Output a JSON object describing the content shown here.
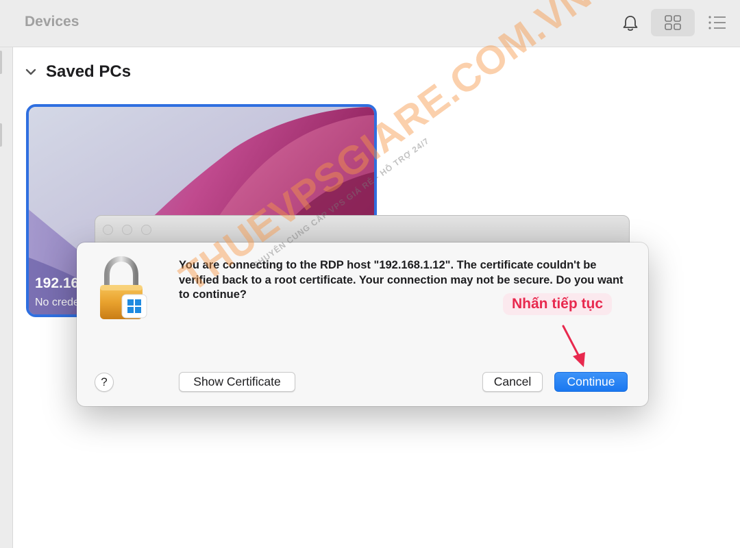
{
  "toolbar": {
    "title": "Devices",
    "icons": [
      "bell-icon",
      "grid-view-icon",
      "list-view-icon"
    ]
  },
  "section": {
    "title": "Saved PCs",
    "icon": "chevron-down-icon"
  },
  "pc_card": {
    "name": "192.16",
    "status": "No crede"
  },
  "dialog": {
    "message": "You are connecting to the RDP host \"192.168.1.12\". The certificate couldn't be verified back to a root certificate. Your connection may not be secure. Do you want to continue?",
    "help_label": "?",
    "show_certificate_label": "Show Certificate",
    "cancel_label": "Cancel",
    "continue_label": "Continue",
    "icon": "lock-icon"
  },
  "annotation": {
    "text": "Nhấn tiếp tục",
    "color": "#e8294e"
  },
  "watermark": {
    "main": "THUEVPSGIARE.COM.VN",
    "sub": "CHUYÊN CUNG CẤP VPS GIÁ RẺ - HỖ TRỢ 24/7"
  },
  "colors": {
    "accent": "#1a78f0",
    "card_border": "#2f6fe0"
  }
}
